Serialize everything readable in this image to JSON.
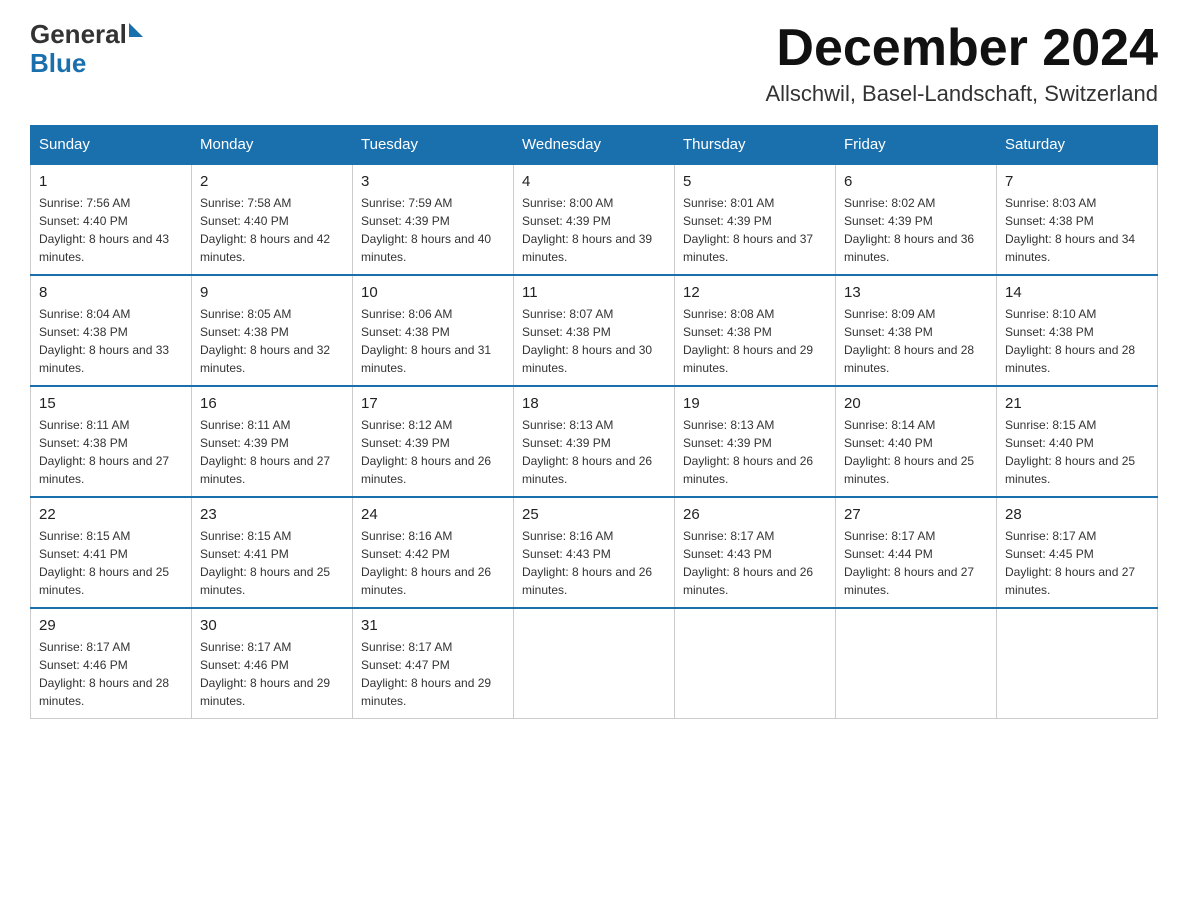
{
  "logo": {
    "general": "General",
    "blue": "Blue"
  },
  "title": "December 2024",
  "location": "Allschwil, Basel-Landschaft, Switzerland",
  "days_of_week": [
    "Sunday",
    "Monday",
    "Tuesday",
    "Wednesday",
    "Thursday",
    "Friday",
    "Saturday"
  ],
  "weeks": [
    [
      {
        "day": "1",
        "sunrise": "7:56 AM",
        "sunset": "4:40 PM",
        "daylight": "8 hours and 43 minutes."
      },
      {
        "day": "2",
        "sunrise": "7:58 AM",
        "sunset": "4:40 PM",
        "daylight": "8 hours and 42 minutes."
      },
      {
        "day": "3",
        "sunrise": "7:59 AM",
        "sunset": "4:39 PM",
        "daylight": "8 hours and 40 minutes."
      },
      {
        "day": "4",
        "sunrise": "8:00 AM",
        "sunset": "4:39 PM",
        "daylight": "8 hours and 39 minutes."
      },
      {
        "day": "5",
        "sunrise": "8:01 AM",
        "sunset": "4:39 PM",
        "daylight": "8 hours and 37 minutes."
      },
      {
        "day": "6",
        "sunrise": "8:02 AM",
        "sunset": "4:39 PM",
        "daylight": "8 hours and 36 minutes."
      },
      {
        "day": "7",
        "sunrise": "8:03 AM",
        "sunset": "4:38 PM",
        "daylight": "8 hours and 34 minutes."
      }
    ],
    [
      {
        "day": "8",
        "sunrise": "8:04 AM",
        "sunset": "4:38 PM",
        "daylight": "8 hours and 33 minutes."
      },
      {
        "day": "9",
        "sunrise": "8:05 AM",
        "sunset": "4:38 PM",
        "daylight": "8 hours and 32 minutes."
      },
      {
        "day": "10",
        "sunrise": "8:06 AM",
        "sunset": "4:38 PM",
        "daylight": "8 hours and 31 minutes."
      },
      {
        "day": "11",
        "sunrise": "8:07 AM",
        "sunset": "4:38 PM",
        "daylight": "8 hours and 30 minutes."
      },
      {
        "day": "12",
        "sunrise": "8:08 AM",
        "sunset": "4:38 PM",
        "daylight": "8 hours and 29 minutes."
      },
      {
        "day": "13",
        "sunrise": "8:09 AM",
        "sunset": "4:38 PM",
        "daylight": "8 hours and 28 minutes."
      },
      {
        "day": "14",
        "sunrise": "8:10 AM",
        "sunset": "4:38 PM",
        "daylight": "8 hours and 28 minutes."
      }
    ],
    [
      {
        "day": "15",
        "sunrise": "8:11 AM",
        "sunset": "4:38 PM",
        "daylight": "8 hours and 27 minutes."
      },
      {
        "day": "16",
        "sunrise": "8:11 AM",
        "sunset": "4:39 PM",
        "daylight": "8 hours and 27 minutes."
      },
      {
        "day": "17",
        "sunrise": "8:12 AM",
        "sunset": "4:39 PM",
        "daylight": "8 hours and 26 minutes."
      },
      {
        "day": "18",
        "sunrise": "8:13 AM",
        "sunset": "4:39 PM",
        "daylight": "8 hours and 26 minutes."
      },
      {
        "day": "19",
        "sunrise": "8:13 AM",
        "sunset": "4:39 PM",
        "daylight": "8 hours and 26 minutes."
      },
      {
        "day": "20",
        "sunrise": "8:14 AM",
        "sunset": "4:40 PM",
        "daylight": "8 hours and 25 minutes."
      },
      {
        "day": "21",
        "sunrise": "8:15 AM",
        "sunset": "4:40 PM",
        "daylight": "8 hours and 25 minutes."
      }
    ],
    [
      {
        "day": "22",
        "sunrise": "8:15 AM",
        "sunset": "4:41 PM",
        "daylight": "8 hours and 25 minutes."
      },
      {
        "day": "23",
        "sunrise": "8:15 AM",
        "sunset": "4:41 PM",
        "daylight": "8 hours and 25 minutes."
      },
      {
        "day": "24",
        "sunrise": "8:16 AM",
        "sunset": "4:42 PM",
        "daylight": "8 hours and 26 minutes."
      },
      {
        "day": "25",
        "sunrise": "8:16 AM",
        "sunset": "4:43 PM",
        "daylight": "8 hours and 26 minutes."
      },
      {
        "day": "26",
        "sunrise": "8:17 AM",
        "sunset": "4:43 PM",
        "daylight": "8 hours and 26 minutes."
      },
      {
        "day": "27",
        "sunrise": "8:17 AM",
        "sunset": "4:44 PM",
        "daylight": "8 hours and 27 minutes."
      },
      {
        "day": "28",
        "sunrise": "8:17 AM",
        "sunset": "4:45 PM",
        "daylight": "8 hours and 27 minutes."
      }
    ],
    [
      {
        "day": "29",
        "sunrise": "8:17 AM",
        "sunset": "4:46 PM",
        "daylight": "8 hours and 28 minutes."
      },
      {
        "day": "30",
        "sunrise": "8:17 AM",
        "sunset": "4:46 PM",
        "daylight": "8 hours and 29 minutes."
      },
      {
        "day": "31",
        "sunrise": "8:17 AM",
        "sunset": "4:47 PM",
        "daylight": "8 hours and 29 minutes."
      },
      null,
      null,
      null,
      null
    ]
  ]
}
